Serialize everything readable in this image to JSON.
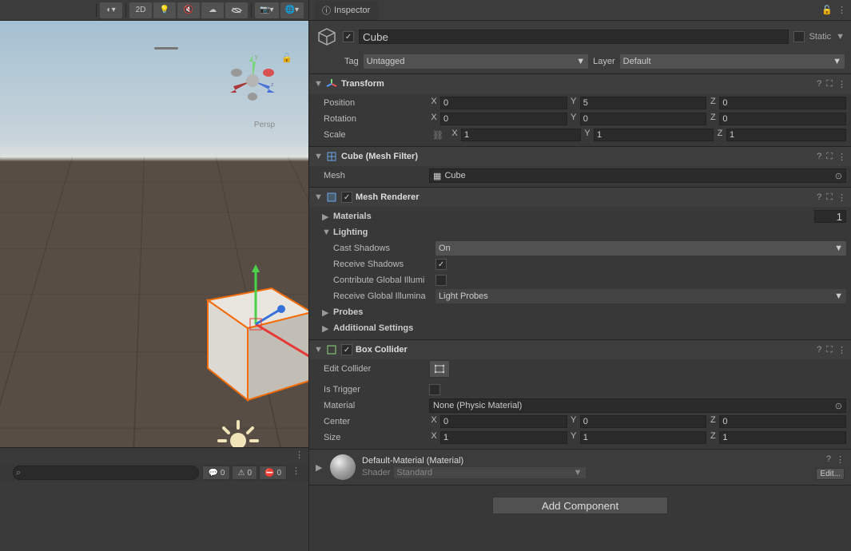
{
  "inspector": {
    "tab_title": "Inspector",
    "object_name": "Cube",
    "object_enabled": true,
    "static_label": "Static",
    "tag_label": "Tag",
    "tag_value": "Untagged",
    "layer_label": "Layer",
    "layer_value": "Default"
  },
  "scene_toolbar": {
    "mode_2d": "2D",
    "persp_label": "Persp"
  },
  "transform": {
    "title": "Transform",
    "position_label": "Position",
    "rotation_label": "Rotation",
    "scale_label": "Scale",
    "position": {
      "x": "0",
      "y": "5",
      "z": "0"
    },
    "rotation": {
      "x": "0",
      "y": "0",
      "z": "0"
    },
    "scale": {
      "x": "1",
      "y": "1",
      "z": "1"
    }
  },
  "mesh_filter": {
    "title": "Cube (Mesh Filter)",
    "mesh_label": "Mesh",
    "mesh_value": "Cube"
  },
  "mesh_renderer": {
    "title": "Mesh Renderer",
    "materials_label": "Materials",
    "materials_count": "1",
    "lighting_label": "Lighting",
    "cast_shadows_label": "Cast Shadows",
    "cast_shadows_value": "On",
    "receive_shadows_label": "Receive Shadows",
    "receive_shadows": true,
    "contribute_gi_label": "Contribute Global Illumi",
    "receive_gi_label": "Receive Global Illumina",
    "receive_gi_value": "Light Probes",
    "probes_label": "Probes",
    "additional_label": "Additional Settings"
  },
  "box_collider": {
    "title": "Box Collider",
    "edit_collider_label": "Edit Collider",
    "is_trigger_label": "Is Trigger",
    "material_label": "Material",
    "material_value": "None (Physic Material)",
    "center_label": "Center",
    "center": {
      "x": "0",
      "y": "0",
      "z": "0"
    },
    "size_label": "Size",
    "size": {
      "x": "1",
      "y": "1",
      "z": "1"
    }
  },
  "material": {
    "name": "Default-Material (Material)",
    "shader_label": "Shader",
    "shader_value": "Standard",
    "edit": "Edit..."
  },
  "add_component": "Add Component",
  "console": {
    "error_count": "0",
    "warn_count": "0",
    "info_count": "0"
  }
}
